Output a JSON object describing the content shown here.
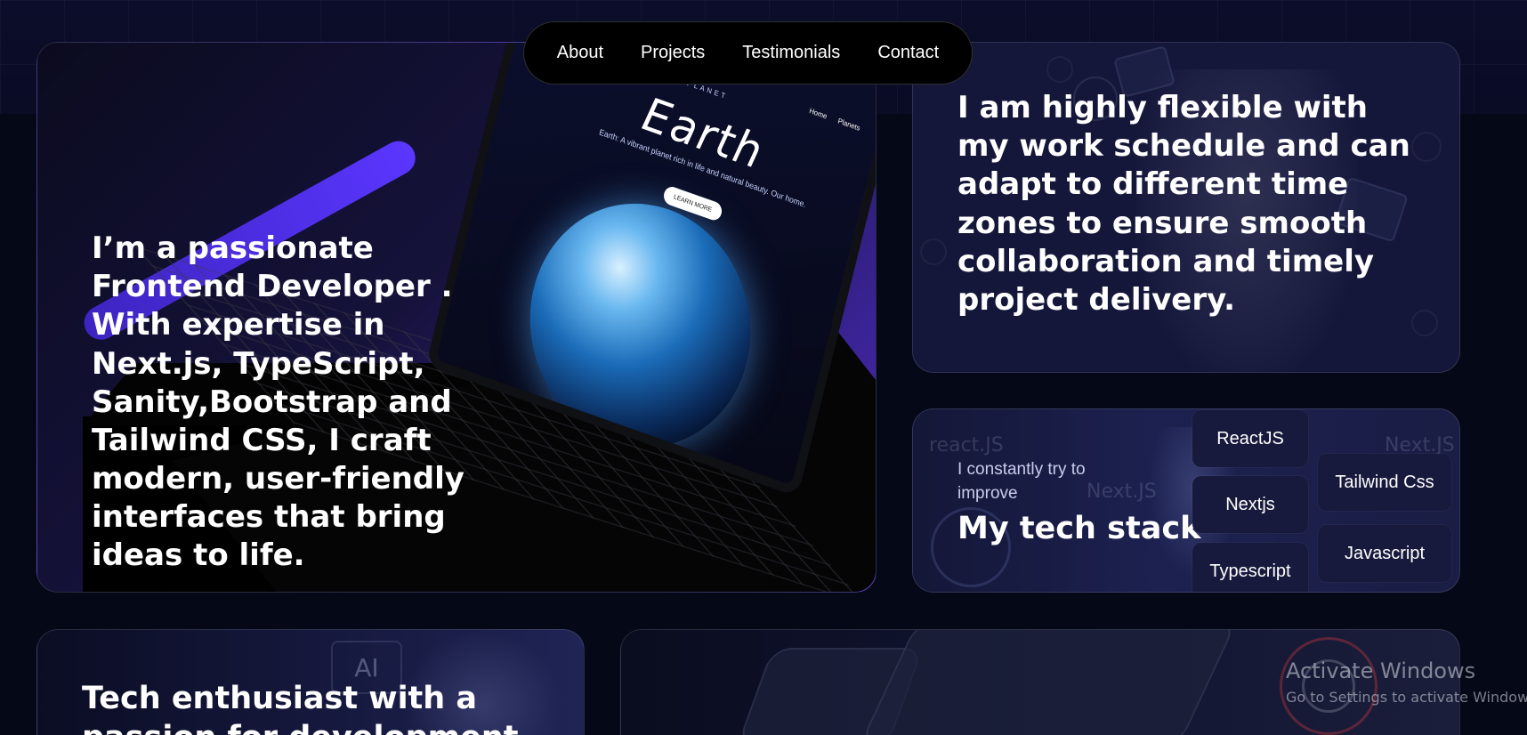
{
  "nav": {
    "items": [
      {
        "label": "About"
      },
      {
        "label": "Projects"
      },
      {
        "label": "Testimonials"
      },
      {
        "label": "Contact"
      }
    ]
  },
  "intro": {
    "text": "I’m a passionate Frontend Developer . With expertise in Next.js, TypeScript, Sanity,Bootstrap and Tailwind CSS, I craft modern, user-friendly interfaces that bring ideas to life.",
    "screen": {
      "brand": "PLANET",
      "title": "Earth",
      "subtitle": "Earth: A vibrant planet rich in life and natural beauty. Our home.",
      "button": "LEARN MORE",
      "nav_home": "Home",
      "nav_planets": "Planets"
    }
  },
  "flexibility": {
    "text": "I am highly flexible with my work schedule and can adapt to different time zones to ensure smooth collaboration and timely project delivery."
  },
  "tech_stack": {
    "subtitle": "I constantly try to improve",
    "title": "My tech stack",
    "background_words": [
      "react.JS",
      "Next.JS",
      "Next.JS"
    ],
    "chips": [
      "ReactJS",
      "Nextjs",
      "Typescript",
      "Tailwind Css",
      "Javascript"
    ]
  },
  "enthusiast": {
    "text": "Tech enthusiast with a passion for development",
    "badge": "AI"
  },
  "watermark": {
    "title": "Activate Windows",
    "subtitle": "Go to Settings to activate Windows."
  },
  "colors": {
    "page_bg": "#050817",
    "card_bg": "#0f112a",
    "accent_purple": "#4b2bb4",
    "chip_bg": "#171a3c",
    "nav_bg": "#000000"
  }
}
